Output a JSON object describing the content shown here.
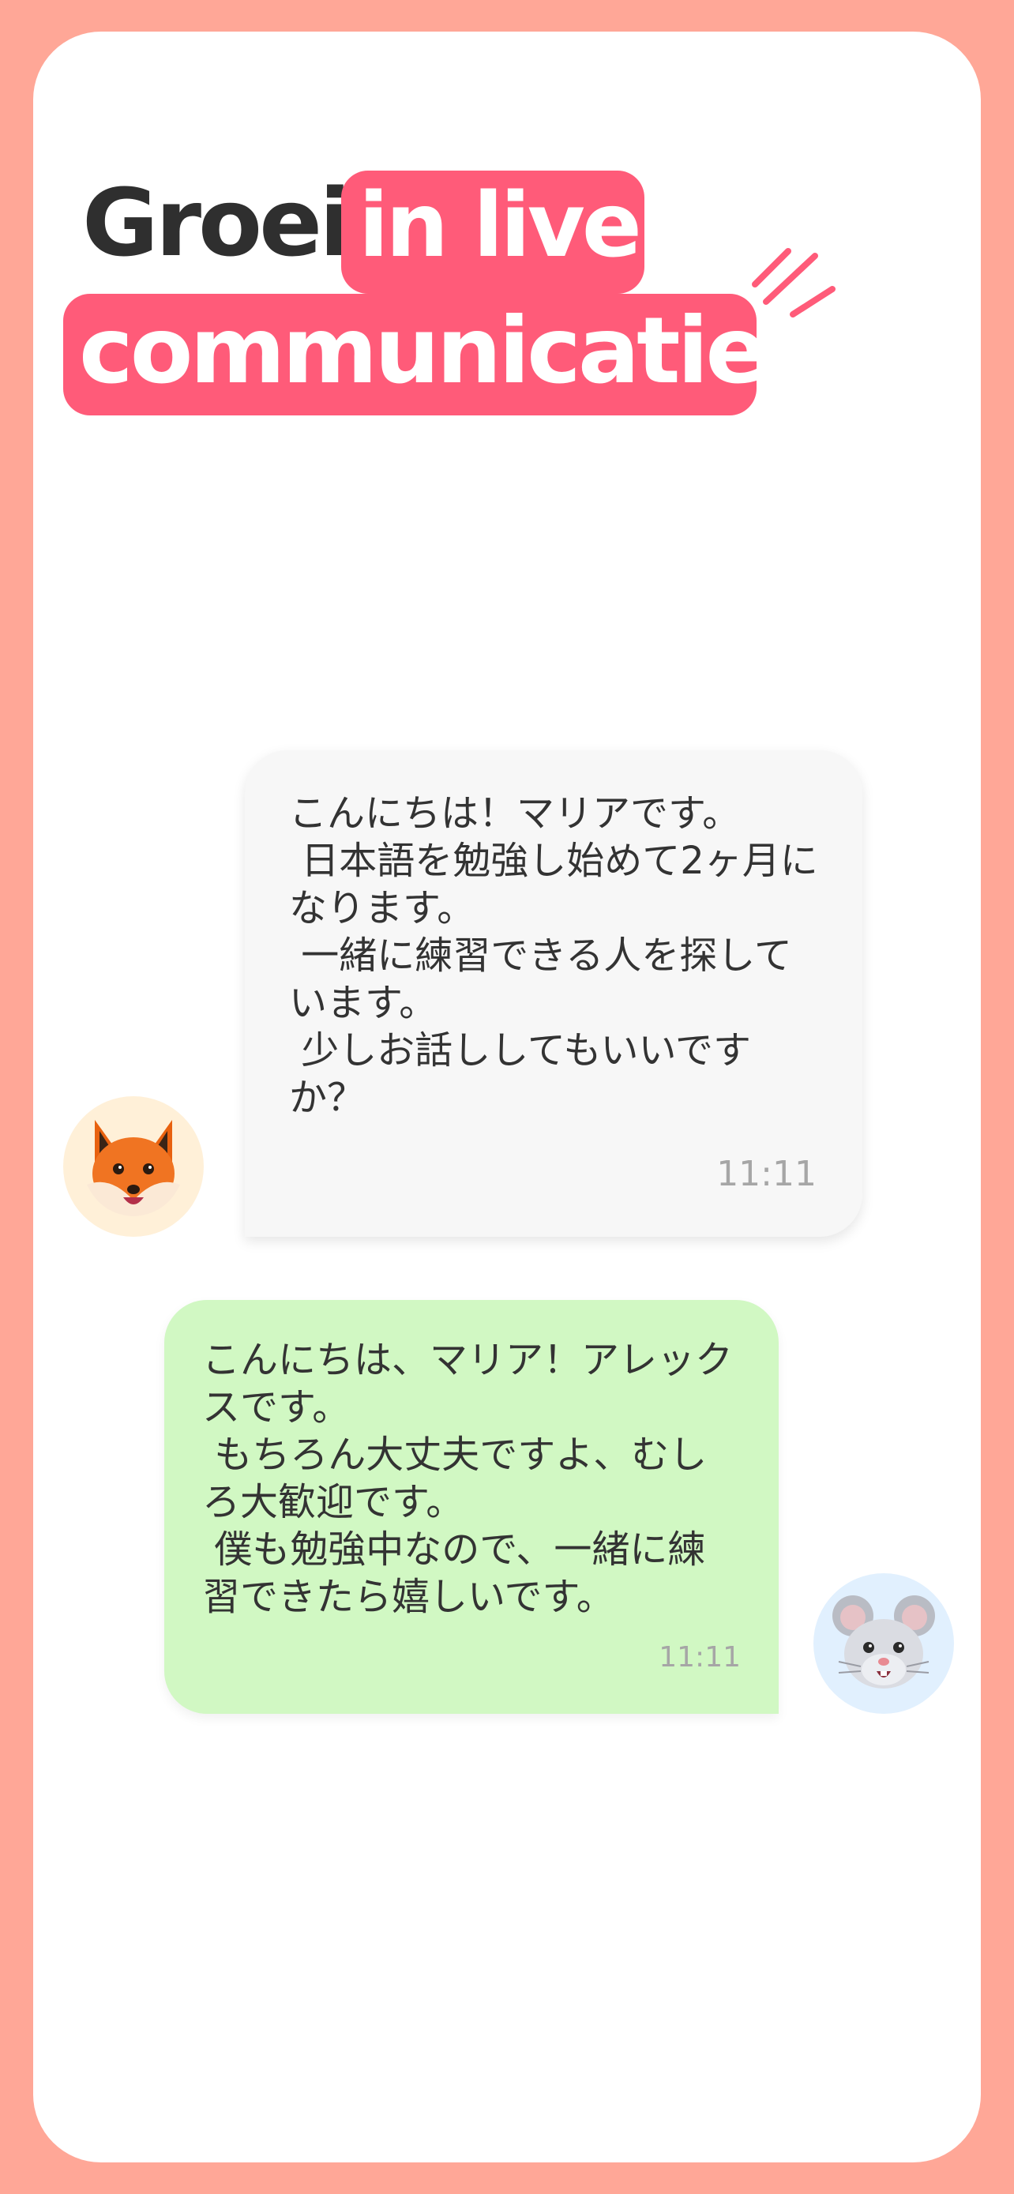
{
  "headline": {
    "plain": "Groei",
    "highlight_1": "in live",
    "highlight_2": "communicatie"
  },
  "messages": [
    {
      "sender": "fox",
      "text": "こんにちは！マリアです。\n 日本語を勉強し始めて2ヶ月になります。\n 一緒に練習できる人を探しています。\n 少しお話ししてもいいですか？",
      "time": "11:11"
    },
    {
      "sender": "mouse",
      "text": "こんにちは、マリア！アレックスです。\n もちろん大丈夫ですよ、むしろ大歓迎です。\n 僕も勉強中なので、一緒に練習できたら嬉しいです。",
      "time": "11:11"
    }
  ],
  "avatars": {
    "incoming": "fox-avatar-icon",
    "outgoing": "mouse-avatar-icon"
  },
  "colors": {
    "frame": "#ffa797",
    "card": "#ffffff",
    "accent": "#ff5b79",
    "incoming_bubble": "#f7f7f7",
    "outgoing_bubble": "#d1f8c3",
    "text": "#333333",
    "time": "#a6a6a6"
  }
}
